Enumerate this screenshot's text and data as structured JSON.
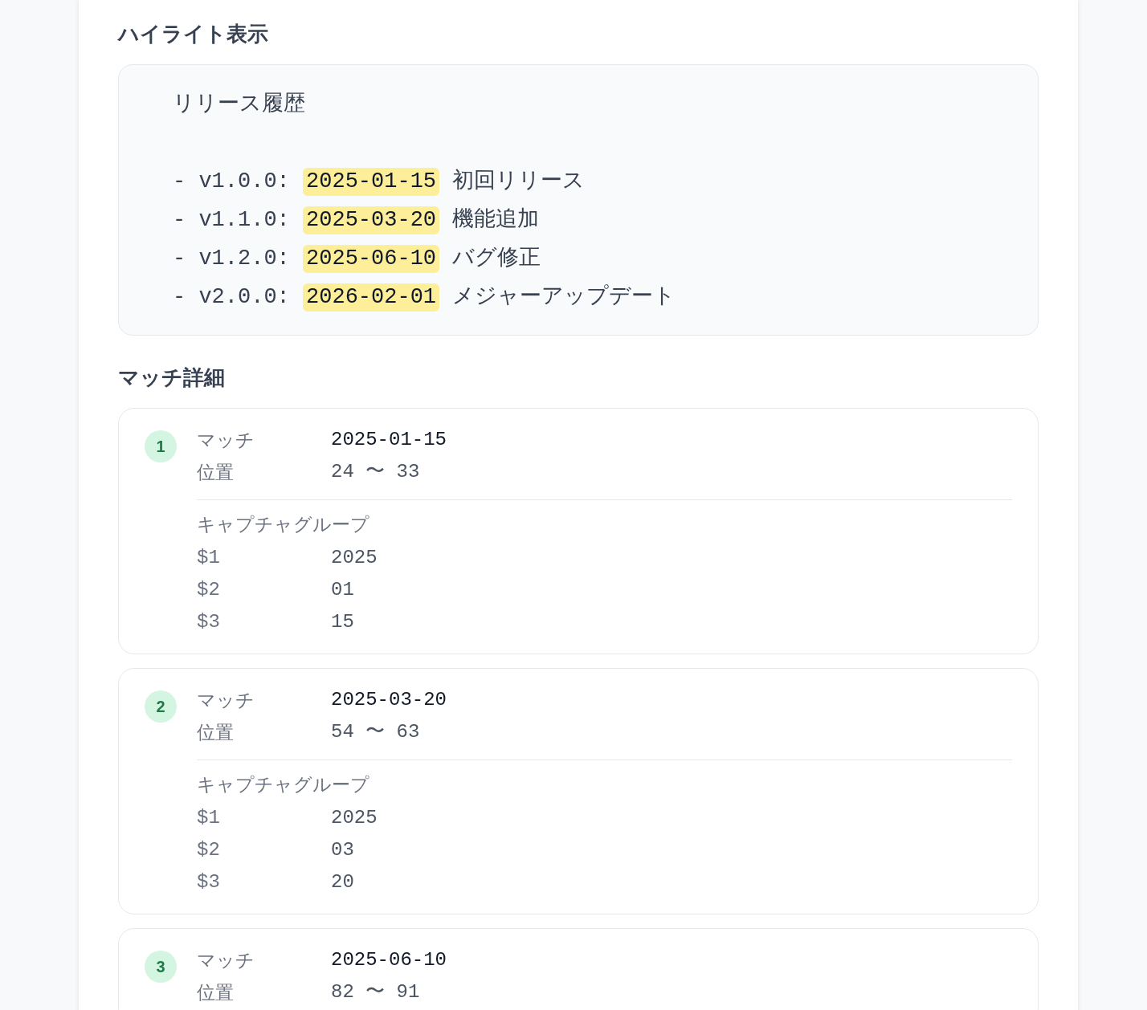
{
  "highlight_section": {
    "title": "ハイライト表示",
    "lines": [
      {
        "kind": "text",
        "segments": [
          {
            "text": "リリース履歴",
            "highlighted": false
          }
        ]
      },
      {
        "kind": "blank"
      },
      {
        "kind": "text",
        "segments": [
          {
            "text": "- v1.0.0: ",
            "highlighted": false
          },
          {
            "text": "2025-01-15",
            "highlighted": true
          },
          {
            "text": " 初回リリース",
            "highlighted": false
          }
        ]
      },
      {
        "kind": "text",
        "segments": [
          {
            "text": "- v1.1.0: ",
            "highlighted": false
          },
          {
            "text": "2025-03-20",
            "highlighted": true
          },
          {
            "text": " 機能追加",
            "highlighted": false
          }
        ]
      },
      {
        "kind": "text",
        "segments": [
          {
            "text": "- v1.2.0: ",
            "highlighted": false
          },
          {
            "text": "2025-06-10",
            "highlighted": true
          },
          {
            "text": " バグ修正",
            "highlighted": false
          }
        ]
      },
      {
        "kind": "text",
        "segments": [
          {
            "text": "- v2.0.0: ",
            "highlighted": false
          },
          {
            "text": "2026-02-01",
            "highlighted": true
          },
          {
            "text": " メジャーアップデート",
            "highlighted": false
          }
        ]
      }
    ]
  },
  "match_section": {
    "title": "マッチ詳細",
    "matches": [
      {
        "number": "1",
        "match_label": "マッチ",
        "match": "2025-01-15",
        "position_label": "位置",
        "position": "24 〜 33",
        "captures_title": "キャプチャグループ",
        "captures": [
          {
            "name": "$1",
            "value": "2025"
          },
          {
            "name": "$2",
            "value": "01"
          },
          {
            "name": "$3",
            "value": "15"
          }
        ]
      },
      {
        "number": "2",
        "match_label": "マッチ",
        "match": "2025-03-20",
        "position_label": "位置",
        "position": "54 〜 63",
        "captures_title": "キャプチャグループ",
        "captures": [
          {
            "name": "$1",
            "value": "2025"
          },
          {
            "name": "$2",
            "value": "03"
          },
          {
            "name": "$3",
            "value": "20"
          }
        ]
      },
      {
        "number": "3",
        "match_label": "マッチ",
        "match": "2025-06-10",
        "position_label": "位置",
        "position": "82 〜 91"
      }
    ]
  }
}
